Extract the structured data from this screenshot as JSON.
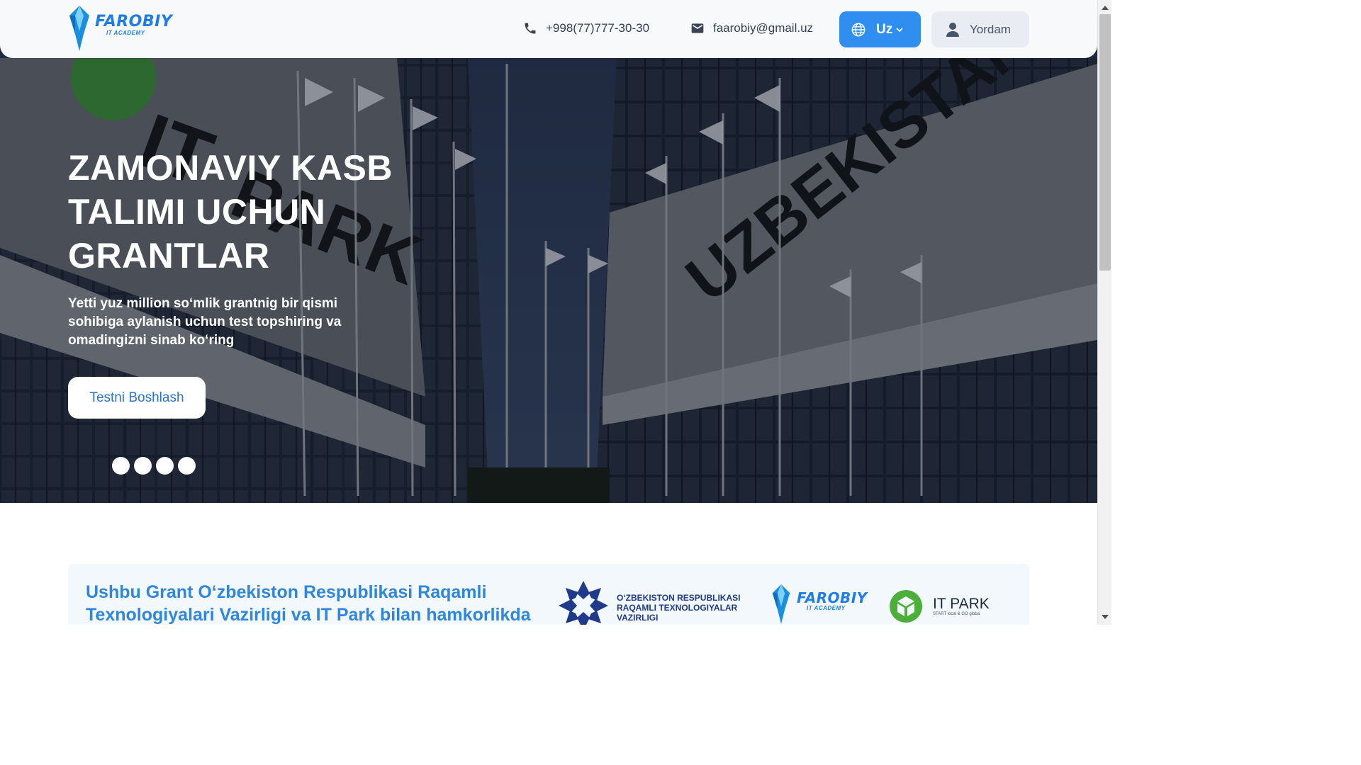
{
  "header": {
    "logo": {
      "name": "FAROBIY",
      "sub": "IT ACADEMY",
      "icon": "farobiy-crystal-logo"
    },
    "phone": {
      "icon": "phone-icon",
      "text": "+998(77)777-30-30"
    },
    "email": {
      "icon": "mail-icon",
      "text": "faarobiy@gmail.uz"
    },
    "language": {
      "icon": "globe-icon",
      "label": "Uz",
      "chevron": "chevron-down-icon"
    },
    "help": {
      "icon": "user-icon",
      "label": "Yordam"
    }
  },
  "hero": {
    "title": "ZAMONAVIY KASB TALIMI UCHUN GRANTLAR",
    "subtitle": "Yetti yuz million so‘mlik grantnig bir qismi sohibiga aylanish uchun test topshiring va omadingizni sinab ko‘ring",
    "cta_label": "Testni Boshlash",
    "slide_count": 4,
    "building_signs": [
      "IT PARK",
      "UZBEKISTAN",
      "ARK"
    ]
  },
  "partner": {
    "text": "Ushbu Grant O‘zbekiston Respublikasi Raqamli Texnologiyalari Vazirligi va IT Park bilan hamkorlikda",
    "ministry": "O‘ZBEKISTON RESPUBLIKASI RAQAMLI TEXNOLOGIYALAR VAZIRLIGI",
    "farobiy": {
      "name": "FAROBIY",
      "sub": "IT ACADEMY"
    },
    "itpark": {
      "name": "IT PARK",
      "tagline": "START local & GO globa"
    }
  },
  "colors": {
    "accent": "#2f8ef0",
    "partner_text": "#2e86de",
    "header_bg": "#f8f9fb",
    "help_bg": "#e9edf3"
  }
}
